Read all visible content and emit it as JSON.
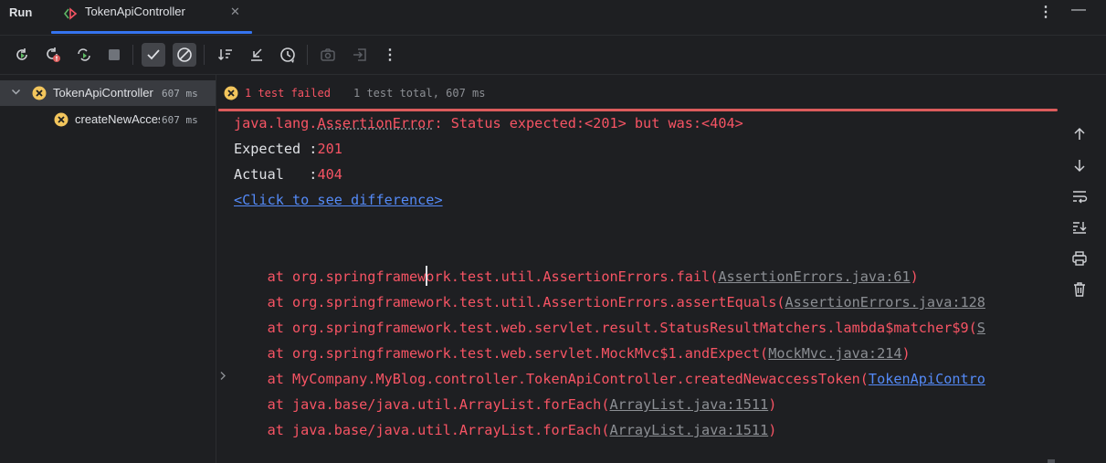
{
  "header": {
    "panel_title": "Run",
    "tab_title": "TokenApiController",
    "tab_close": "✕",
    "more_menu": "⋮",
    "minimize": "—"
  },
  "toolbar": {
    "buttons": [
      "rerun-icon",
      "rerun-failed-icon",
      "toggle-auto-test-icon",
      "stop-icon",
      "show-passed-icon",
      "show-ignored-icon",
      "sort-icon",
      "collapse-icon",
      "history-icon",
      "screenshot-icon",
      "export-icon",
      "more-icon"
    ],
    "more": "⋮"
  },
  "tree": {
    "items": [
      {
        "name": "TokenApiController",
        "time": "607 ms",
        "status": "failed"
      },
      {
        "name": "createNewAccessToken",
        "time": "607 ms",
        "status": "failed"
      }
    ]
  },
  "status": {
    "failed": "1 test failed",
    "total": "1 test total, 607 ms"
  },
  "console": {
    "error_prefix": "java.lang.",
    "error_class": "AssertionError",
    "error_msg": ": Status expected:<201> but was:<404>",
    "expected_label": "Expected :",
    "expected_value": "201",
    "actual_label": "Actual   :",
    "actual_value": "404",
    "diff_link": "<Click to see difference>",
    "stack": [
      {
        "text": "    at org.springframework.test.util.AssertionErrors.fail(",
        "link": "AssertionErrors.java:61",
        "end": ")",
        "link_style": "gray"
      },
      {
        "text": "    at org.springframework.test.util.AssertionErrors.assertEquals(",
        "link": "AssertionErrors.java:128",
        "end": "",
        "link_style": "gray"
      },
      {
        "text": "    at org.springframework.test.web.servlet.result.StatusResultMatchers.lambda$matcher$9(",
        "link": "S",
        "end": "",
        "link_style": "gray"
      },
      {
        "text": "    at org.springframework.test.web.servlet.MockMvc$1.andExpect(",
        "link": "MockMvc.java:214",
        "end": ")",
        "link_style": "gray"
      },
      {
        "text": "    at MyCompany.MyBlog.controller.TokenApiController.createdNewaccessToken(",
        "link": "TokenApiContro",
        "end": "",
        "link_style": "blue"
      },
      {
        "text": "    at java.base/java.util.ArrayList.forEach(",
        "link": "ArrayList.java:1511",
        "end": ")",
        "link_style": "gray"
      },
      {
        "text": "    at java.base/java.util.ArrayList.forEach(",
        "link": "ArrayList.java:1511",
        "end": ")",
        "link_style": "gray"
      }
    ]
  },
  "side_tools": [
    "up-arrow-icon",
    "down-arrow-icon",
    "soft-wrap-icon",
    "scroll-to-end-icon",
    "print-icon",
    "trash-icon"
  ],
  "colors": {
    "background": "#1e1f22",
    "error_red": "#f75464",
    "link_blue": "#548af7",
    "accent": "#3574f0",
    "fail_badge": "#f2c55c"
  }
}
